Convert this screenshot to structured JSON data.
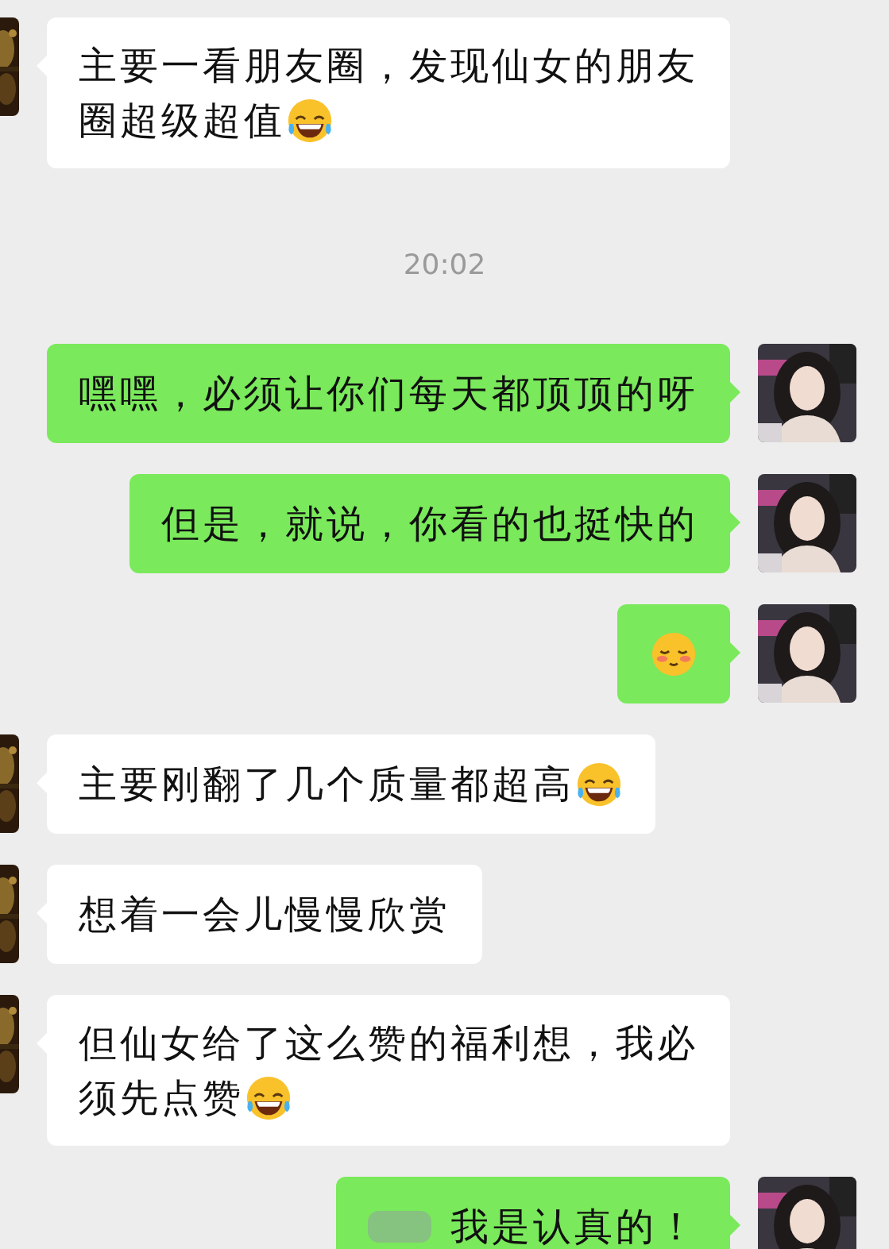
{
  "messages": [
    {
      "kind": "incoming",
      "lines": [
        "主要一看朋友圈，发现仙女的朋友",
        "圈超级超值"
      ],
      "emoji": {
        "kind": "laugh"
      }
    },
    {
      "kind": "time",
      "text": "20:02"
    },
    {
      "kind": "outgoing",
      "lines": [
        "嘿嘿，必须让你们每天都顶顶的呀"
      ]
    },
    {
      "kind": "outgoing",
      "lines": [
        "但是，就说，你看的也挺快的"
      ]
    },
    {
      "kind": "outgoing",
      "emoji": {
        "kind": "blush"
      }
    },
    {
      "kind": "incoming",
      "lines": [
        "主要刚翻了几个质量都超高"
      ],
      "emoji": {
        "kind": "laugh"
      }
    },
    {
      "kind": "incoming",
      "lines": [
        "想着一会儿慢慢欣赏"
      ]
    },
    {
      "kind": "incoming",
      "lines": [
        "但仙女给了这么赞的福利想，我必",
        "须先点赞"
      ],
      "emoji": {
        "kind": "laugh"
      }
    },
    {
      "kind": "outgoing",
      "lines": [
        "我是认真的！"
      ],
      "blurred": true
    }
  ]
}
